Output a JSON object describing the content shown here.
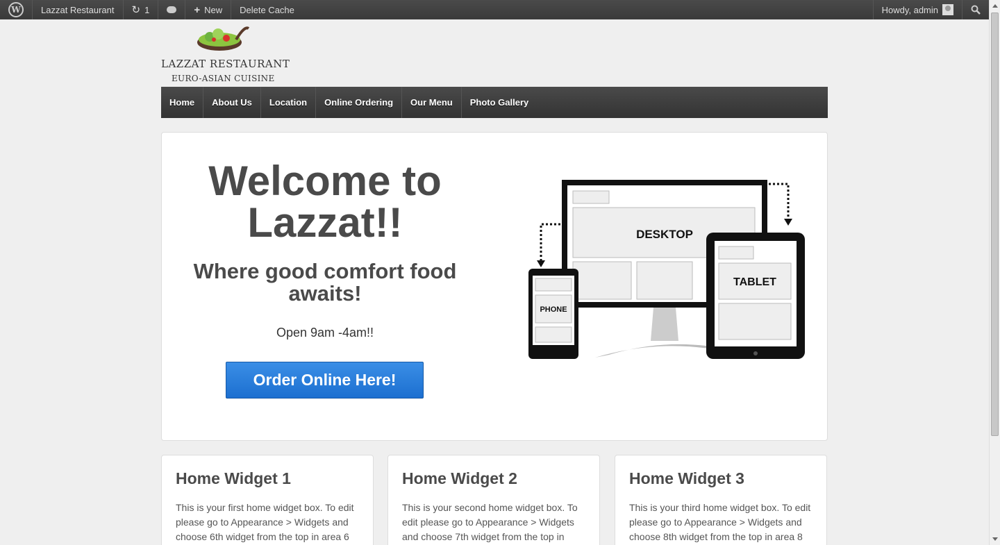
{
  "adminbar": {
    "site_name": "Lazzat Restaurant",
    "updates_count": "1",
    "new_label": "New",
    "cache_label": "Delete Cache",
    "howdy": "Howdy, admin"
  },
  "brand": {
    "name": "LAZZAT RESTAURANT",
    "tagline": "EURO-ASIAN CUISINE"
  },
  "nav": {
    "items": [
      "Home",
      "About Us",
      "Location",
      "Online Ordering",
      "Our Menu",
      "Photo Gallery"
    ]
  },
  "hero": {
    "title": "Welcome to Lazzat!!",
    "subtitle": "Where good comfort food awaits!",
    "hours": "Open 9am -4am!!",
    "button": "Order Online Here!",
    "device_labels": {
      "desktop": "DESKTOP",
      "tablet": "TABLET",
      "phone": "PHONE"
    }
  },
  "widgets": [
    {
      "title": "Home Widget 1",
      "text": "This is your first home widget box. To edit please go to Appearance > Widgets and choose 6th widget from the top in area 6"
    },
    {
      "title": "Home Widget 2",
      "text": "This is your second home widget box. To edit please go to Appearance > Widgets and choose 7th widget from the top in"
    },
    {
      "title": "Home Widget 3",
      "text": "This is your third home widget box. To edit please go to Appearance > Widgets and choose 8th widget from the top in area 8"
    }
  ],
  "colors": {
    "button_blue": "#2a7fe0",
    "nav_dark": "#3d3d3d",
    "admin_bar": "#434343"
  }
}
